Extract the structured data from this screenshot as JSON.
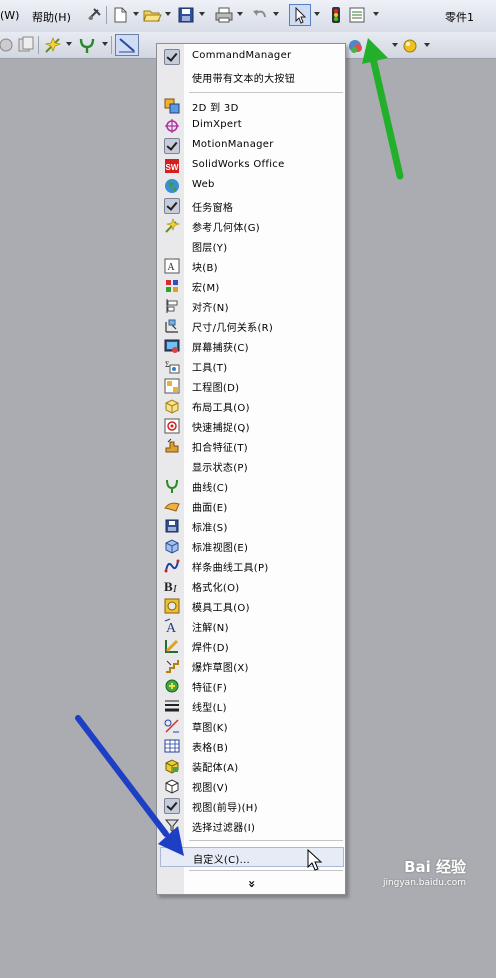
{
  "menubar": {
    "left_fragment": "(W)",
    "help": "帮助(H)",
    "document_title": "零件1"
  },
  "menu": {
    "top_items": [
      {
        "label": "CommandManager",
        "checked": true
      },
      {
        "label": "使用带有文本的大按钮",
        "checked": false
      }
    ],
    "items": [
      {
        "label": "2D 到 3D",
        "icon": "2d-to-3d-icon",
        "checked": false
      },
      {
        "label": "DimXpert",
        "icon": "dimxpert-icon",
        "checked": false
      },
      {
        "label": "MotionManager",
        "icon": "",
        "checked": true
      },
      {
        "label": "SolidWorks Office",
        "icon": "solidworks-office-icon",
        "checked": false
      },
      {
        "label": "Web",
        "icon": "globe-icon",
        "checked": false
      },
      {
        "label": "任务窗格",
        "icon": "",
        "checked": true
      },
      {
        "label": "参考几何体(G)",
        "icon": "reference-geometry-icon",
        "checked": false
      },
      {
        "label": "图层(Y)",
        "icon": "",
        "checked": false
      },
      {
        "label": "块(B)",
        "icon": "block-icon",
        "checked": false
      },
      {
        "label": "宏(M)",
        "icon": "macro-icon",
        "checked": false
      },
      {
        "label": "对齐(N)",
        "icon": "align-icon",
        "checked": false
      },
      {
        "label": "尺寸/几何关系(R)",
        "icon": "dimension-icon",
        "checked": false
      },
      {
        "label": "屏幕捕获(C)",
        "icon": "screen-capture-icon",
        "checked": false
      },
      {
        "label": "工具(T)",
        "icon": "tools-icon",
        "checked": false
      },
      {
        "label": "工程图(D)",
        "icon": "drawing-icon",
        "checked": false
      },
      {
        "label": "布局工具(O)",
        "icon": "layout-tools-icon",
        "checked": false
      },
      {
        "label": "快速捕捉(Q)",
        "icon": "quick-snap-icon",
        "checked": false
      },
      {
        "label": "扣合特征(T)",
        "icon": "fastening-features-icon",
        "checked": false
      },
      {
        "label": "显示状态(P)",
        "icon": "",
        "checked": false
      },
      {
        "label": "曲线(C)",
        "icon": "curves-icon",
        "checked": false
      },
      {
        "label": "曲面(E)",
        "icon": "surfaces-icon",
        "checked": false
      },
      {
        "label": "标准(S)",
        "icon": "standard-icon",
        "checked": false
      },
      {
        "label": "标准视图(E)",
        "icon": "standard-views-icon",
        "checked": false
      },
      {
        "label": "样条曲线工具(P)",
        "icon": "spline-tools-icon",
        "checked": false
      },
      {
        "label": "格式化(O)",
        "icon": "format-icon",
        "checked": false
      },
      {
        "label": "模具工具(O)",
        "icon": "mold-tools-icon",
        "checked": false
      },
      {
        "label": "注解(N)",
        "icon": "annotation-icon",
        "checked": false
      },
      {
        "label": "焊件(D)",
        "icon": "weldments-icon",
        "checked": false
      },
      {
        "label": "爆炸草图(X)",
        "icon": "explode-sketch-icon",
        "checked": false
      },
      {
        "label": "特征(F)",
        "icon": "features-icon",
        "checked": false
      },
      {
        "label": "线型(L)",
        "icon": "line-format-icon",
        "checked": false
      },
      {
        "label": "草图(K)",
        "icon": "sketch-icon",
        "checked": false
      },
      {
        "label": "表格(B)",
        "icon": "table-icon",
        "checked": false
      },
      {
        "label": "装配体(A)",
        "icon": "assembly-icon",
        "checked": false
      },
      {
        "label": "视图(V)",
        "icon": "view-icon",
        "checked": false
      },
      {
        "label": "视图(前导)(H)",
        "icon": "",
        "checked": true
      },
      {
        "label": "选择过滤器(I)",
        "icon": "selection-filter-icon",
        "checked": false
      }
    ],
    "customize": "自定义(C)...",
    "expand_glyph": "»"
  },
  "watermark": {
    "text": "Bai 经验",
    "url": "jingyan.baidu.com"
  },
  "colors": {
    "arrow_green": "#22b02a",
    "arrow_blue": "#1d3fc4",
    "background": "#aaacb2"
  }
}
